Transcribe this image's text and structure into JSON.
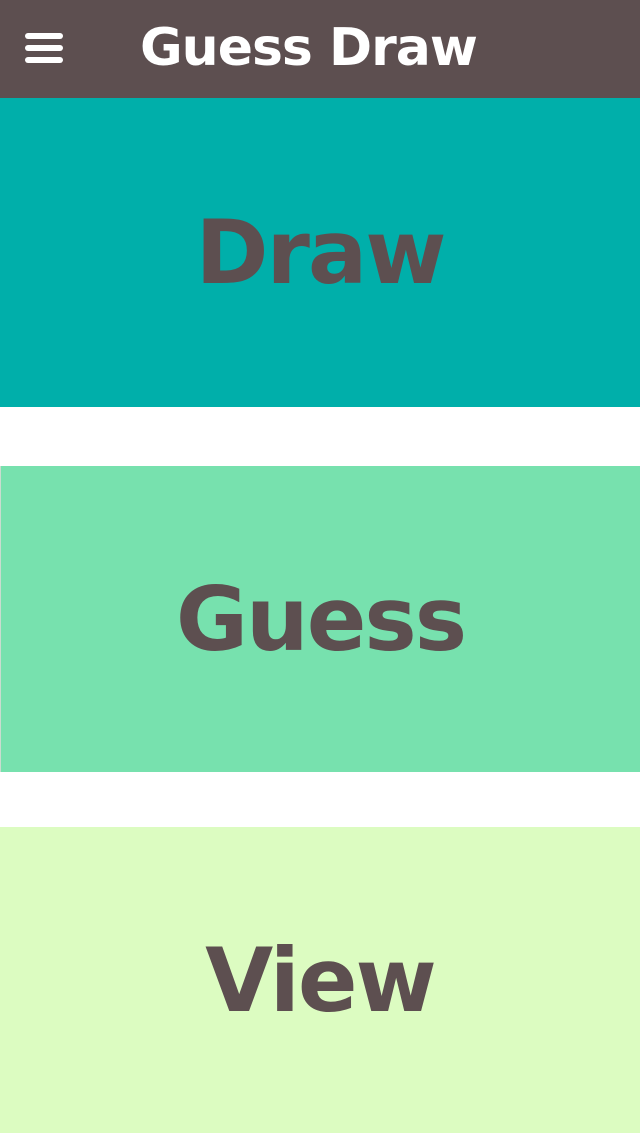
{
  "header": {
    "title": "Guess Draw",
    "menu_icon": "hamburger-menu-icon",
    "background": "#5d4f50",
    "title_color": "#ffffff"
  },
  "tiles": [
    {
      "label": "Draw",
      "background": "#00afaa",
      "text_color": "#5d4f50"
    },
    {
      "label": "Guess",
      "background": "#77e1ae",
      "text_color": "#5d4f50"
    },
    {
      "label": "View",
      "background": "#dcfcc1",
      "text_color": "#5d4f50"
    }
  ]
}
